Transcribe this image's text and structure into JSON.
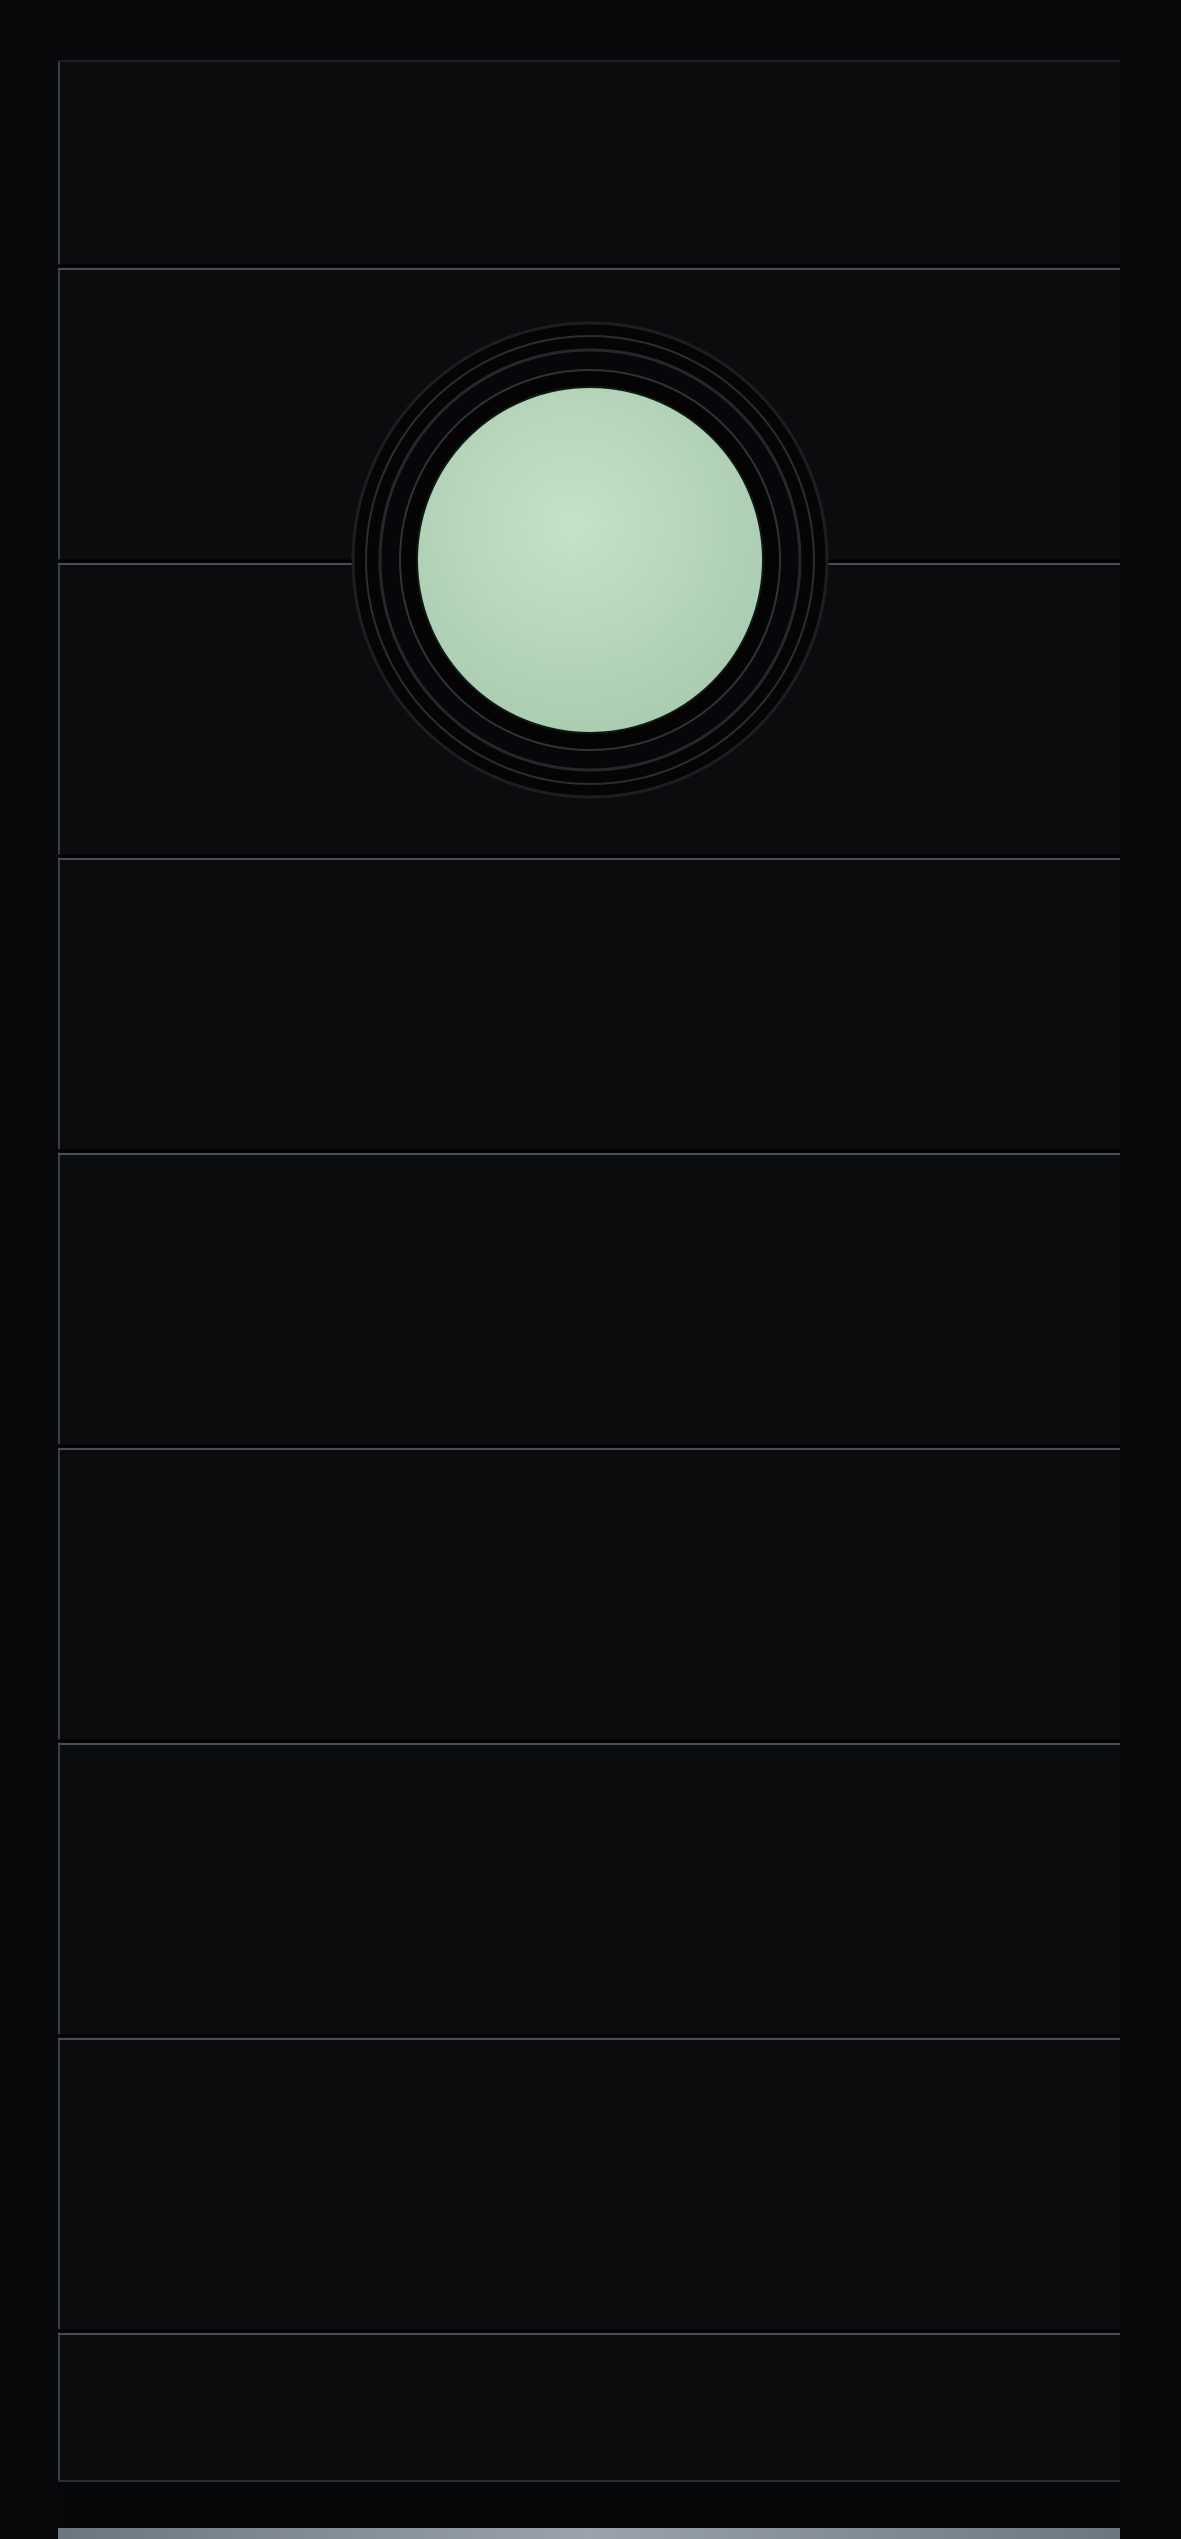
{
  "door": {
    "panel_color": "#0b0c0e",
    "frame_color": "#08090b",
    "groove_highlight": "#4a4d55",
    "groove_shadow": "#000000",
    "groove_count": 8,
    "porthole": {
      "glass_color": "#c6e2c8",
      "glass_color_edge": "#a9cbb0",
      "frame_color": "#050506"
    },
    "kick_plate_color": "#9aa3ab"
  }
}
